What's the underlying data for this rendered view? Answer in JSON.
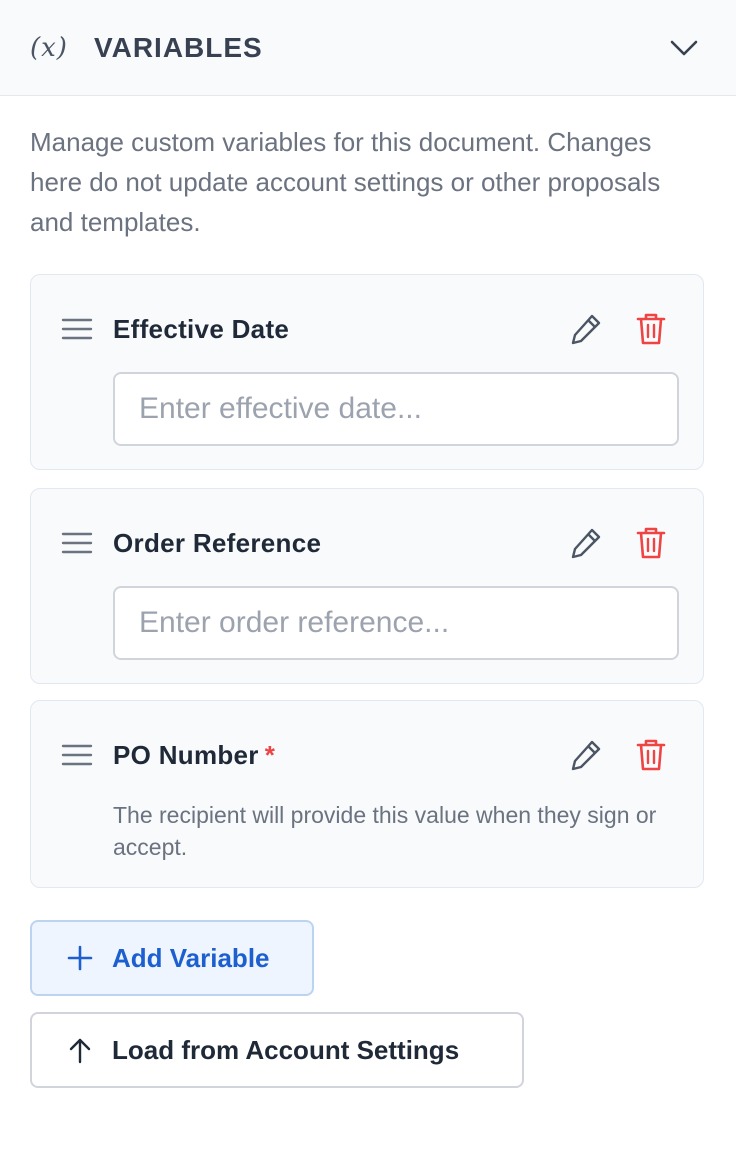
{
  "header": {
    "icon": "variable-icon",
    "icon_text": "(x)",
    "title": "VARIABLES",
    "toggle_icon": "chevron-down-icon"
  },
  "description": "Manage custom variables for this document. Changes here do not update account settings or other proposals and templates.",
  "variables": [
    {
      "name": "Effective Date",
      "required": false,
      "placeholder": "Enter effective date..."
    },
    {
      "name": "Order Reference",
      "required": false,
      "placeholder": "Enter order reference..."
    },
    {
      "name": "PO Number",
      "required": true,
      "required_mark": "*",
      "note": "The recipient will provide this value when they sign or accept."
    }
  ],
  "actions": {
    "add_label": "Add Variable",
    "load_label": "Load from Account Settings"
  },
  "colors": {
    "accent": "#1d5fcf",
    "danger": "#ef4444",
    "muted_text": "#6b7280",
    "card_bg": "#f8fafc"
  }
}
